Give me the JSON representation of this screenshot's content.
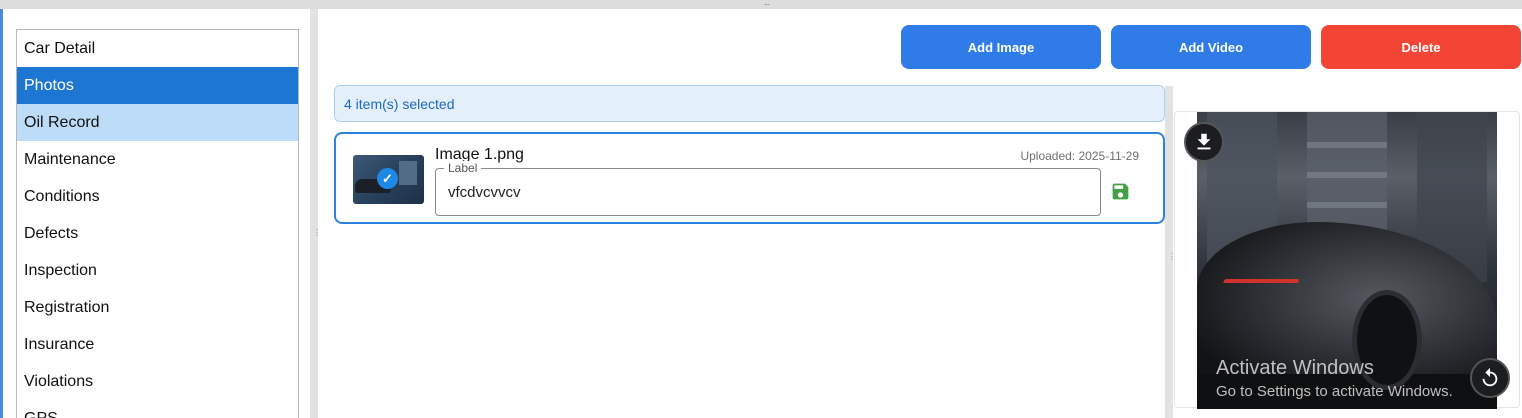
{
  "sidebar": {
    "items": [
      {
        "label": "Car Detail"
      },
      {
        "label": "Photos"
      },
      {
        "label": "Oil Record"
      },
      {
        "label": "Maintenance"
      },
      {
        "label": "Conditions"
      },
      {
        "label": "Defects"
      },
      {
        "label": "Inspection"
      },
      {
        "label": "Registration"
      },
      {
        "label": "Insurance"
      },
      {
        "label": "Violations"
      },
      {
        "label": "GPS"
      }
    ],
    "active_item": "Photos"
  },
  "toolbar": {
    "add_image_label": "Add Image",
    "add_video_label": "Add Video",
    "delete_label": "Delete"
  },
  "selection": {
    "status": "4 item(s) selected"
  },
  "files": [
    {
      "name": "Image 1.png",
      "uploaded": "Uploaded: 2025-11-29",
      "label_field": {
        "caption": "Label",
        "value": "vfcdvcvvcv"
      }
    }
  ],
  "watermark": {
    "title": "Activate Windows",
    "subtitle": "Go to Settings to activate Windows."
  },
  "icons": {
    "check": "check-icon",
    "save": "floppy-disk-icon",
    "download": "download-icon",
    "rotate": "rotate-icon"
  },
  "colors": {
    "primary": "#2f7be8",
    "danger": "#f24536",
    "sidebar_active": "#1e76d3",
    "sidebar_hover": "#bcdcf7",
    "save_icon": "#43a047"
  }
}
